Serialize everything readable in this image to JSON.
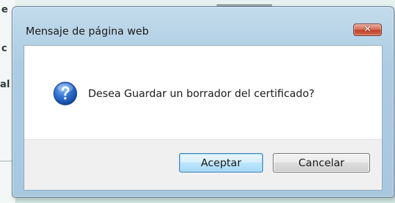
{
  "background_page": {
    "visible_fragments": [
      "e",
      "c",
      "al"
    ]
  },
  "dialog": {
    "title": "Mensaje de página web",
    "close_icon_glyph": "✕",
    "icon": "question-icon",
    "message": "Desea Guardar un borrador del certificado?",
    "buttons": {
      "ok_label": "Aceptar",
      "cancel_label": "Cancelar"
    }
  },
  "colors": {
    "frame": "#adcce3",
    "close_button": "#c0412c",
    "question_icon": "#1f62c4",
    "default_button_border": "#3c7fb1",
    "button_area": "#f0f0f0"
  }
}
